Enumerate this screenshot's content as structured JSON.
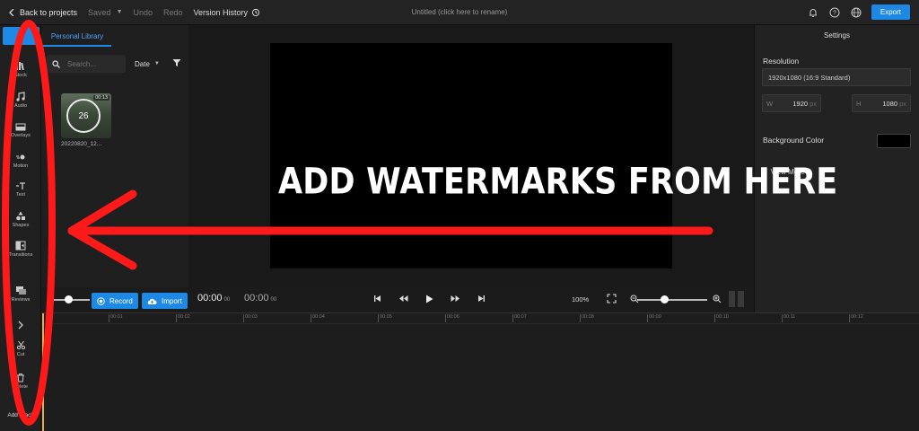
{
  "topbar": {
    "back_label": "Back to projects",
    "saved_label": "Saved",
    "undo_label": "Undo",
    "redo_label": "Redo",
    "version_history_label": "Version History",
    "project_title": "Untitled (click here to rename)",
    "export_label": "Export"
  },
  "rail": {
    "items": [
      {
        "label": "Stock",
        "icon": "stock-icon"
      },
      {
        "label": "Audio",
        "icon": "music-note-icon"
      },
      {
        "label": "Overlays",
        "icon": "overlays-icon"
      },
      {
        "label": "Motion",
        "icon": "motion-icon"
      },
      {
        "label": "Text",
        "icon": "text-icon"
      },
      {
        "label": "Shapes",
        "icon": "shapes-icon"
      },
      {
        "label": "Transitions",
        "icon": "transitions-icon"
      },
      {
        "label": "Reviews",
        "icon": "reviews-icon"
      },
      {
        "label": "Cut",
        "icon": "scissors-icon"
      },
      {
        "label": "Delete",
        "icon": "trash-icon"
      },
      {
        "label": "Add Track",
        "icon": ""
      }
    ]
  },
  "library": {
    "tab_label": "Personal Library",
    "search_placeholder": "Search...",
    "sort_label": "Date",
    "item": {
      "duration": "00:13",
      "countdown": "26",
      "name": "20220820_12..."
    }
  },
  "settings": {
    "title": "Settings",
    "resolution_label": "Resolution",
    "resolution_value": "1920x1080 (16:9 Standard)",
    "width_key": "W",
    "width_value": "1920",
    "height_key": "H",
    "height_value": "1080",
    "unit": "px",
    "bg_color_label": "Background Color",
    "bg_color": "#000000",
    "view_more_label": "View More"
  },
  "transport": {
    "record_label": "Record",
    "import_label": "Import",
    "current_time": "00:00",
    "current_frames": "00",
    "total_time": "00:00",
    "total_frames": "00",
    "zoom_percent": "100%"
  },
  "timeline": {
    "ticks": [
      "00:01",
      "00:02",
      "00:03",
      "00:04",
      "00:05",
      "00:06",
      "00:07",
      "00:08",
      "00:09",
      "00:10",
      "00:11",
      "00:12"
    ]
  },
  "annotation": {
    "text": "ADD WATERMARKS FROM HERE",
    "color": "#ff1a1a"
  },
  "colors": {
    "accent": "#1e88e5",
    "background": "#1b1b1b",
    "playhead": "#e0b23c"
  }
}
